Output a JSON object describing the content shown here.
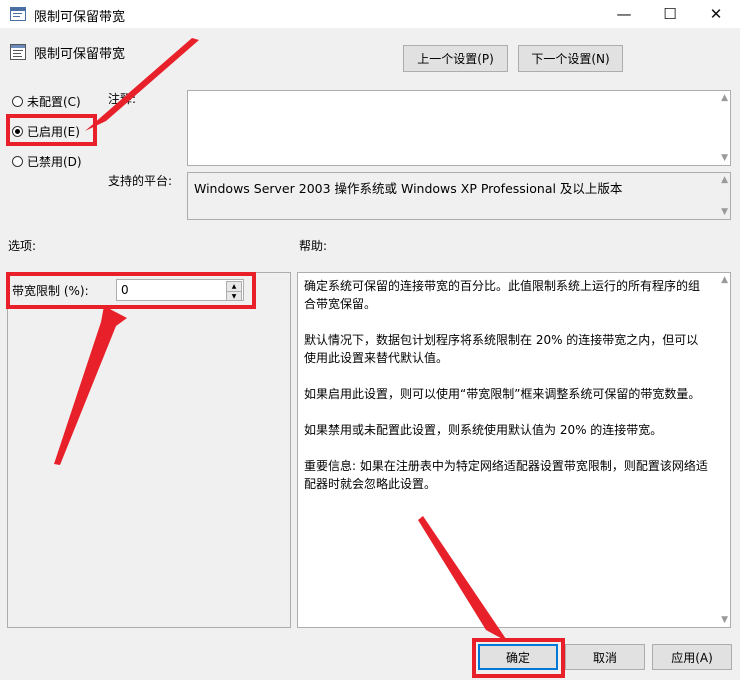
{
  "window": {
    "title": "限制可保留带宽",
    "controls": {
      "minimize": "—",
      "maximize": "☐",
      "close": "✕"
    }
  },
  "header": {
    "policy_name": "限制可保留带宽",
    "prev_button": "上一个设置(P)",
    "next_button": "下一个设置(N)"
  },
  "state_options": [
    {
      "label": "未配置(C)",
      "selected": false
    },
    {
      "label": "已启用(E)",
      "selected": true
    },
    {
      "label": "已禁用(D)",
      "selected": false
    }
  ],
  "comment": {
    "label": "注释:",
    "value": ""
  },
  "platform": {
    "label": "支持的平台:",
    "value": "Windows Server 2003 操作系统或 Windows XP Professional 及以上版本"
  },
  "options": {
    "label": "选项:",
    "bandwidth_label": "带宽限制 (%):",
    "bandwidth_value": "0"
  },
  "help": {
    "label": "帮助:",
    "paragraphs": [
      "确定系统可保留的连接带宽的百分比。此值限制系统上运行的所有程序的组合带宽保留。",
      "默认情况下，数据包计划程序将系统限制在 20% 的连接带宽之内，但可以使用此设置来替代默认值。",
      "如果启用此设置，则可以使用“带宽限制”框来调整系统可保留的带宽数量。",
      "如果禁用或未配置此设置，则系统使用默认值为 20% 的连接带宽。",
      "重要信息: 如果在注册表中为特定网络适配器设置带宽限制，则配置该网络适配器时就会忽略此设置。"
    ]
  },
  "footer": {
    "ok": "确定",
    "cancel": "取消",
    "apply": "应用(A)"
  },
  "colors": {
    "annotation": "#e8202a",
    "focus": "#0078d7"
  }
}
